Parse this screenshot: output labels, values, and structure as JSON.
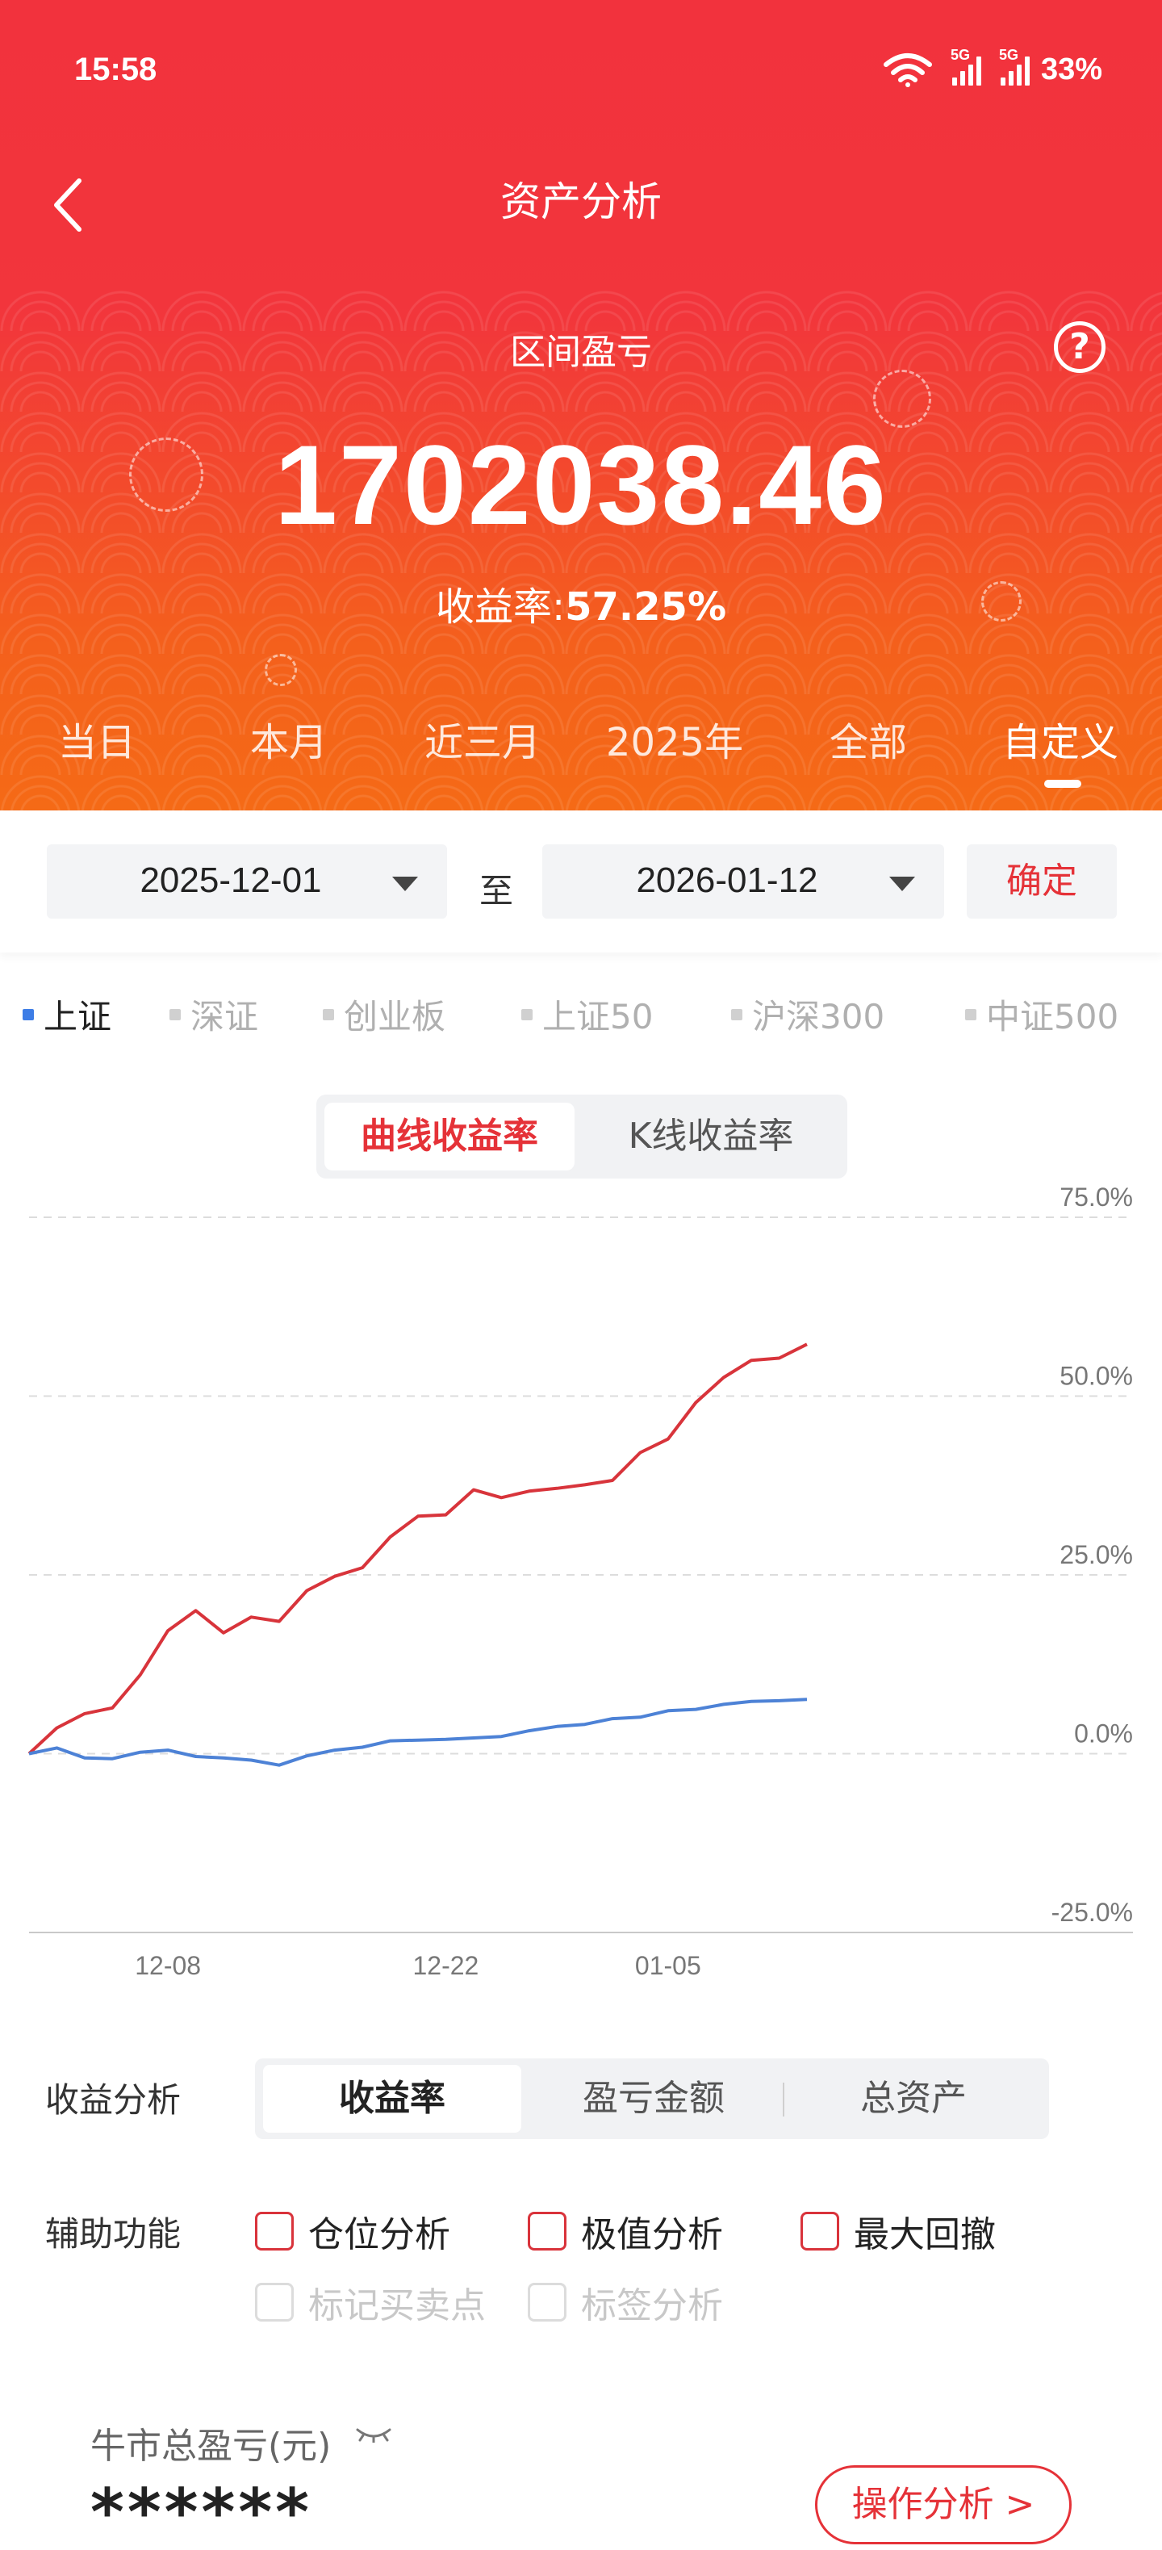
{
  "status_bar": {
    "time": "15:58",
    "net1": "5G",
    "net2": "5G",
    "battery": "33%"
  },
  "header": {
    "title": "资产分析",
    "range_label": "区间盈亏",
    "amount": "1702038.46",
    "rate_prefix": "收益率:",
    "rate_value": "57.25%",
    "help_label": "?"
  },
  "period_tabs": [
    "当日",
    "本月",
    "近三月",
    "2025年",
    "全部",
    "自定义"
  ],
  "active_period": "自定义",
  "date_range": {
    "start": "2025-12-01",
    "to_label": "至",
    "end": "2026-01-12",
    "confirm": "确定"
  },
  "indices": [
    "上证",
    "深证",
    "创业板",
    "上证50",
    "沪深300",
    "中证500"
  ],
  "chart_toggle": {
    "curve": "曲线收益率",
    "kline": "K线收益率"
  },
  "colors": {
    "accent": "#e53238",
    "header": "#f2323d",
    "portfolio_line": "#d8343b",
    "index_line": "#4d82d6"
  },
  "chart_data": {
    "type": "line",
    "x": [
      "2025-12-01",
      "2025-12-02",
      "2025-12-03",
      "2025-12-04",
      "2025-12-05",
      "2025-12-08",
      "2025-12-09",
      "2025-12-10",
      "2025-12-11",
      "2025-12-12",
      "2025-12-15",
      "2025-12-16",
      "2025-12-17",
      "2025-12-18",
      "2025-12-19",
      "2025-12-22",
      "2025-12-23",
      "2025-12-24",
      "2025-12-25",
      "2025-12-26",
      "2025-12-29",
      "2025-12-30",
      "2025-12-31",
      "2026-01-05",
      "2026-01-06",
      "2026-01-07",
      "2026-01-08",
      "2026-01-09",
      "2026-01-12"
    ],
    "xticks": [
      "12-08",
      "12-22",
      "01-05"
    ],
    "yticks": [
      "75.0%",
      "50.0%",
      "25.0%",
      "0.0%",
      "-25.0%"
    ],
    "ylim": [
      -25,
      75
    ],
    "series": [
      {
        "values": [
          0.0,
          3.6,
          5.6,
          6.4,
          11.0,
          17.2,
          20.0,
          16.9,
          19.1,
          18.5,
          22.8,
          24.8,
          26.0,
          30.3,
          33.2,
          33.4,
          36.9,
          35.8,
          36.7,
          37.1,
          37.6,
          38.2,
          42.1,
          44.0,
          49.1,
          52.6,
          55.0,
          55.3,
          57.25
        ]
      },
      {
        "values": [
          0.0,
          0.8,
          -0.6,
          -0.7,
          0.2,
          0.5,
          -0.4,
          -0.6,
          -0.9,
          -1.6,
          -0.3,
          0.5,
          0.9,
          1.8,
          1.9,
          2.0,
          2.2,
          2.4,
          3.2,
          3.8,
          4.1,
          4.9,
          5.1,
          6.0,
          6.2,
          6.9,
          7.3,
          7.4,
          7.6
        ]
      }
    ]
  },
  "analysis": {
    "label": "收益分析",
    "tabs": [
      "收益率",
      "盈亏金额",
      "总资产"
    ],
    "active_tab": "收益率"
  },
  "aux": {
    "label": "辅助功能",
    "options": [
      "仓位分析",
      "极值分析",
      "最大回撤"
    ],
    "disabled_options": [
      "标记买卖点",
      "标签分析"
    ]
  },
  "bull": {
    "label": "牛市总盈亏(元)",
    "value": "******",
    "button": "操作分析 >"
  }
}
